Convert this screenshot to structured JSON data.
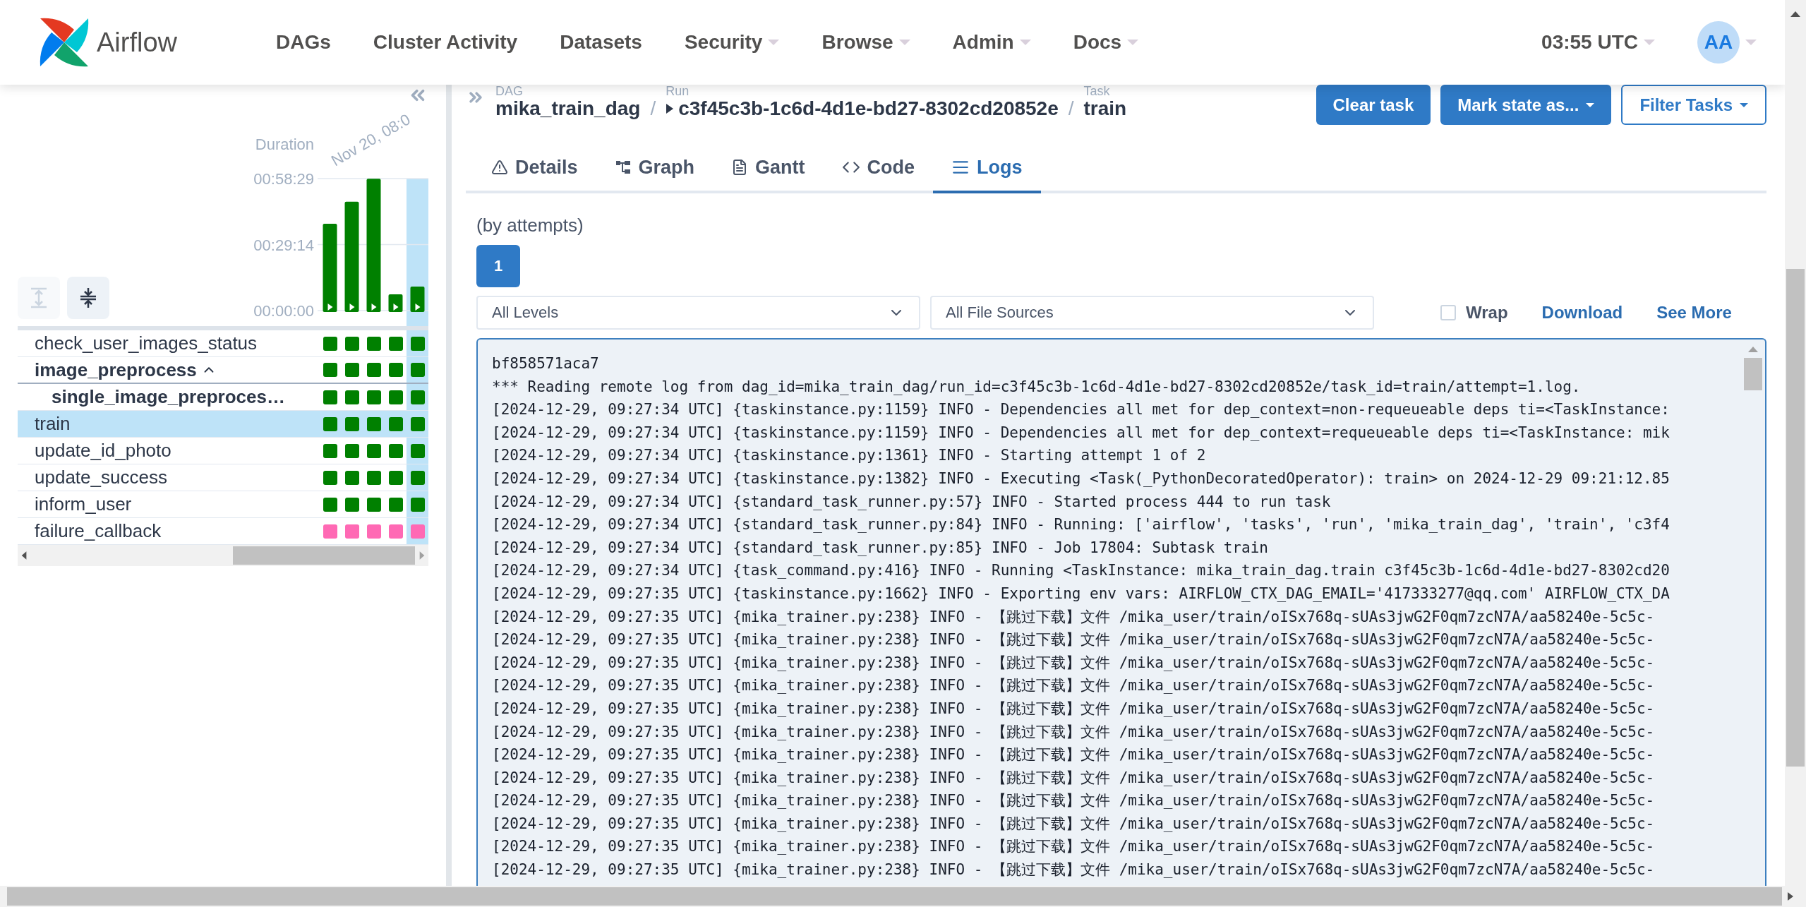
{
  "header": {
    "brand": "Airflow",
    "nav": [
      {
        "label": "DAGs",
        "dropdown": false
      },
      {
        "label": "Cluster Activity",
        "dropdown": false
      },
      {
        "label": "Datasets",
        "dropdown": false
      },
      {
        "label": "Security",
        "dropdown": true
      },
      {
        "label": "Browse",
        "dropdown": true
      },
      {
        "label": "Admin",
        "dropdown": true
      },
      {
        "label": "Docs",
        "dropdown": true
      }
    ],
    "time": "03:55 UTC",
    "avatar": "AA"
  },
  "grid": {
    "chart_data": {
      "type": "bar",
      "title": "Duration",
      "values": [
        38.5,
        48.2,
        58.4,
        7.2,
        10.6
      ],
      "ylim": [
        0,
        58.48
      ],
      "yticks": [
        {
          "value": 0,
          "label": "00:00:00"
        },
        {
          "value": 29.24,
          "label": "00:29:14"
        },
        {
          "value": 58.48,
          "label": "00:58:29"
        }
      ],
      "annotations": [
        "Nov 20, 08:0"
      ]
    },
    "runs": [
      {
        "selected": false
      },
      {
        "selected": false
      },
      {
        "selected": false
      },
      {
        "selected": false
      },
      {
        "selected": true
      }
    ],
    "tasks": [
      {
        "name": "check_user_images_status",
        "kind": "task",
        "color": "#008000",
        "selected": false
      },
      {
        "name": "image_preprocess",
        "kind": "group",
        "expanded": true,
        "color": "#008000",
        "selected": false,
        "children": [
          {
            "name": "single_image_preproces…",
            "kind": "group",
            "color": "#008000",
            "selected": false
          }
        ]
      },
      {
        "name": "train",
        "kind": "task",
        "color": "#008000",
        "selected": true
      },
      {
        "name": "update_id_photo",
        "kind": "task",
        "color": "#008000",
        "selected": false
      },
      {
        "name": "update_success",
        "kind": "task",
        "color": "#008000",
        "selected": false
      },
      {
        "name": "inform_user",
        "kind": "task",
        "color": "#008000",
        "selected": false
      },
      {
        "name": "failure_callback",
        "kind": "task",
        "color": "#ff69b4",
        "selected": false
      }
    ]
  },
  "breadcrumb": [
    {
      "label": "DAG",
      "value": "mika_train_dag",
      "kind": "dag"
    },
    {
      "label": "Run",
      "value": "c3f45c3b-1c6d-4d1e-bd27-8302cd20852e",
      "kind": "run",
      "separator": "/"
    },
    {
      "label": "Task",
      "value": "train",
      "kind": "task",
      "separator": "/"
    }
  ],
  "actions": [
    {
      "label": "Clear task",
      "kind": "solid",
      "dropdown": false
    },
    {
      "label": "Mark state as...",
      "kind": "solid",
      "dropdown": true
    },
    {
      "label": "Filter Tasks",
      "kind": "outline",
      "dropdown": true
    }
  ],
  "tabs": [
    {
      "label": "Details",
      "selected": false
    },
    {
      "label": "Graph",
      "selected": false
    },
    {
      "label": "Gantt",
      "selected": false
    },
    {
      "label": "Code",
      "selected": false
    },
    {
      "label": "Logs",
      "selected": true
    }
  ],
  "logs": {
    "attempts_label": "(by attempts)",
    "attempts": [
      {
        "label": "1",
        "selected": true
      }
    ],
    "level_filter": "All Levels",
    "source_filter": "All File Sources",
    "wrap": {
      "label": "Wrap",
      "checked": false
    },
    "links": [
      "Download",
      "See More"
    ],
    "lines": [
      "bf858571aca7",
      "*** Reading remote log from dag_id=mika_train_dag/run_id=c3f45c3b-1c6d-4d1e-bd27-8302cd20852e/task_id=train/attempt=1.log.",
      "[2024-12-29, 09:27:34 UTC] {taskinstance.py:1159} INFO - Dependencies all met for dep_context=non-requeueable deps ti=<TaskInstance:",
      "[2024-12-29, 09:27:34 UTC] {taskinstance.py:1159} INFO - Dependencies all met for dep_context=requeueable deps ti=<TaskInstance: mik",
      "[2024-12-29, 09:27:34 UTC] {taskinstance.py:1361} INFO - Starting attempt 1 of 2",
      "[2024-12-29, 09:27:34 UTC] {taskinstance.py:1382} INFO - Executing <Task(_PythonDecoratedOperator): train> on 2024-12-29 09:21:12.85",
      "[2024-12-29, 09:27:34 UTC] {standard_task_runner.py:57} INFO - Started process 444 to run task",
      "[2024-12-29, 09:27:34 UTC] {standard_task_runner.py:84} INFO - Running: ['airflow', 'tasks', 'run', 'mika_train_dag', 'train', 'c3f4",
      "[2024-12-29, 09:27:34 UTC] {standard_task_runner.py:85} INFO - Job 17804: Subtask train",
      "[2024-12-29, 09:27:34 UTC] {task_command.py:416} INFO - Running <TaskInstance: mika_train_dag.train c3f45c3b-1c6d-4d1e-bd27-8302cd20",
      "[2024-12-29, 09:27:35 UTC] {taskinstance.py:1662} INFO - Exporting env vars: AIRFLOW_CTX_DAG_EMAIL='417333277@qq.com' AIRFLOW_CTX_DA",
      "[2024-12-29, 09:27:35 UTC] {mika_trainer.py:238} INFO - 【跳过下载】文件 /mika_user/train/oISx768q-sUAs3jwG2F0qm7zcN7A/aa58240e-5c5c-",
      "[2024-12-29, 09:27:35 UTC] {mika_trainer.py:238} INFO - 【跳过下载】文件 /mika_user/train/oISx768q-sUAs3jwG2F0qm7zcN7A/aa58240e-5c5c-",
      "[2024-12-29, 09:27:35 UTC] {mika_trainer.py:238} INFO - 【跳过下载】文件 /mika_user/train/oISx768q-sUAs3jwG2F0qm7zcN7A/aa58240e-5c5c-",
      "[2024-12-29, 09:27:35 UTC] {mika_trainer.py:238} INFO - 【跳过下载】文件 /mika_user/train/oISx768q-sUAs3jwG2F0qm7zcN7A/aa58240e-5c5c-",
      "[2024-12-29, 09:27:35 UTC] {mika_trainer.py:238} INFO - 【跳过下载】文件 /mika_user/train/oISx768q-sUAs3jwG2F0qm7zcN7A/aa58240e-5c5c-",
      "[2024-12-29, 09:27:35 UTC] {mika_trainer.py:238} INFO - 【跳过下载】文件 /mika_user/train/oISx768q-sUAs3jwG2F0qm7zcN7A/aa58240e-5c5c-",
      "[2024-12-29, 09:27:35 UTC] {mika_trainer.py:238} INFO - 【跳过下载】文件 /mika_user/train/oISx768q-sUAs3jwG2F0qm7zcN7A/aa58240e-5c5c-",
      "[2024-12-29, 09:27:35 UTC] {mika_trainer.py:238} INFO - 【跳过下载】文件 /mika_user/train/oISx768q-sUAs3jwG2F0qm7zcN7A/aa58240e-5c5c-",
      "[2024-12-29, 09:27:35 UTC] {mika_trainer.py:238} INFO - 【跳过下载】文件 /mika_user/train/oISx768q-sUAs3jwG2F0qm7zcN7A/aa58240e-5c5c-",
      "[2024-12-29, 09:27:35 UTC] {mika_trainer.py:238} INFO - 【跳过下载】文件 /mika_user/train/oISx768q-sUAs3jwG2F0qm7zcN7A/aa58240e-5c5c-",
      "[2024-12-29, 09:27:35 UTC] {mika_trainer.py:238} INFO - 【跳过下载】文件 /mika_user/train/oISx768q-sUAs3jwG2F0qm7zcN7A/aa58240e-5c5c-",
      "[2024-12-29, 09:27:35 UTC] {mika_trainer.py:238} INFO - 【跳过下载】文件 /mika_user/train/oISx768q-sUAs3jwG2F0qm7zcN7A/aa58240e-5c5c-"
    ]
  }
}
